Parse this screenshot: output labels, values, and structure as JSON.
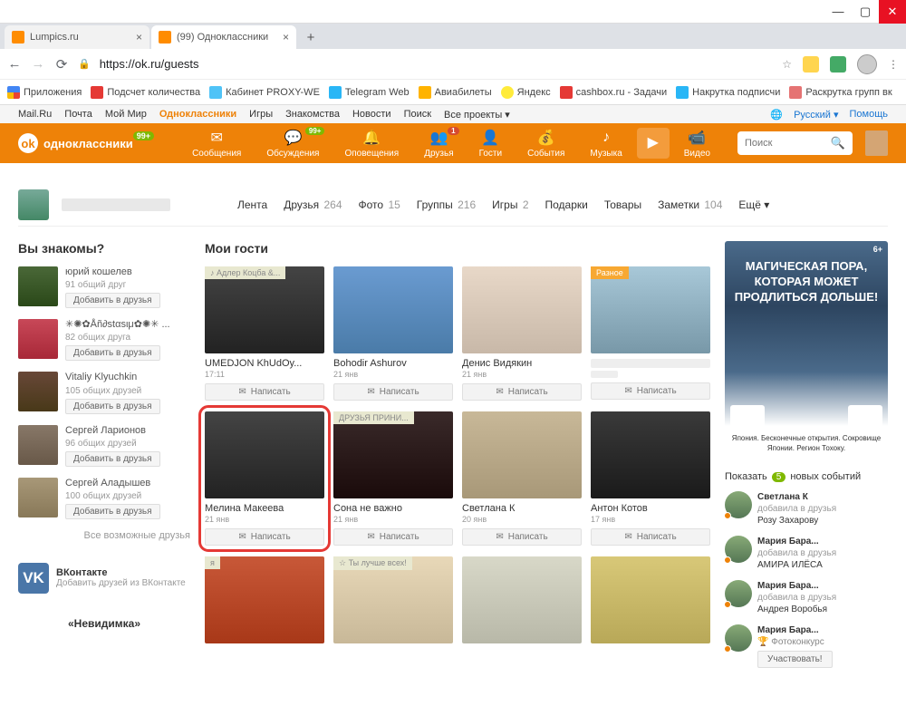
{
  "window": {
    "title": "(99) Одноклассники"
  },
  "tabs": [
    {
      "title": "Lumpics.ru",
      "active": false
    },
    {
      "title": "(99) Одноклассники",
      "active": true
    }
  ],
  "url": "https://ok.ru/guests",
  "bookmarks": [
    "Приложения",
    "Подсчет количества",
    "Кабинет PROXY-WE",
    "Telegram Web",
    "Авиабилеты",
    "Яндекс",
    "cashbox.ru - Задачи",
    "Накрутка подписчи",
    "Раскрутка групп вк"
  ],
  "mailru": {
    "links": [
      "Mail.Ru",
      "Почта",
      "Мой Мир",
      "Одноклассники",
      "Игры",
      "Знакомства",
      "Новости",
      "Поиск",
      "Все проекты ▾"
    ],
    "active_link": "Одноклассники",
    "lang": "Русский ▾",
    "help": "Помощь"
  },
  "ok_header": {
    "logo": "одноклассники",
    "logo_badge": "99+",
    "nav": [
      {
        "icon": "✉",
        "label": "Сообщения",
        "badge": ""
      },
      {
        "icon": "💬",
        "label": "Обсуждения",
        "badge": "99+"
      },
      {
        "icon": "🔔",
        "label": "Оповещения",
        "badge": ""
      },
      {
        "icon": "👥",
        "label": "Друзья",
        "badge": "1",
        "badge_red": true
      },
      {
        "icon": "👤",
        "label": "Гости",
        "badge": ""
      },
      {
        "icon": "💰",
        "label": "События",
        "badge": ""
      },
      {
        "icon": "♪",
        "label": "Музыка",
        "badge": ""
      }
    ],
    "play_label": "",
    "video_label": "Видео",
    "search_placeholder": "Поиск"
  },
  "profile_tabs": [
    {
      "label": "Лента",
      "count": ""
    },
    {
      "label": "Друзья",
      "count": "264"
    },
    {
      "label": "Фото",
      "count": "15"
    },
    {
      "label": "Группы",
      "count": "216"
    },
    {
      "label": "Игры",
      "count": "2"
    },
    {
      "label": "Подарки",
      "count": ""
    },
    {
      "label": "Товары",
      "count": ""
    },
    {
      "label": "Заметки",
      "count": "104"
    },
    {
      "label": "Ещё ▾",
      "count": ""
    }
  ],
  "suggestions": {
    "title": "Вы знакомы?",
    "items": [
      {
        "name": "юрий кошелев",
        "meta": "91 общий друг",
        "btn": "Добавить в друзья"
      },
      {
        "name": "✳✺✿Åñ∂stαsιμ✿✺✳ ...",
        "meta": "82 общих друга",
        "btn": "Добавить в друзья"
      },
      {
        "name": "Vitaliy Klyuchkin",
        "meta": "105 общих друзей",
        "btn": "Добавить в друзья"
      },
      {
        "name": "Сергей Ларионов",
        "meta": "96 общих друзей",
        "btn": "Добавить в друзья"
      },
      {
        "name": "Сергей Аладышев",
        "meta": "100 общих друзей",
        "btn": "Добавить в друзья"
      }
    ],
    "all": "Все возможные друзья"
  },
  "vk": {
    "title": "ВКонтакте",
    "sub": "Добавить друзей из ВКонтакте"
  },
  "invisible": "«Невидимка»",
  "guests": {
    "title": "Мои гости",
    "write_label": "Написать",
    "cards": [
      {
        "tag": "♪ Адлер Коцба &...",
        "name": "UMEDJON KhUdOy...",
        "date": "17:11",
        "gp": "gp1"
      },
      {
        "tag": null,
        "name": "Bohodir Ashurov",
        "date": "21 янв",
        "gp": "gp2"
      },
      {
        "tag": null,
        "name": "Денис Видякин",
        "date": "21 янв",
        "gp": "gp3"
      },
      {
        "tag": "Разное",
        "tag_orange": true,
        "name": "",
        "date": "",
        "gp": "gp4",
        "blurred": true
      },
      {
        "tag": null,
        "name": "Мелина Макеева",
        "date": "21 янв",
        "gp": "gp5",
        "highlighted": true
      },
      {
        "tag": "ДРУЗЬЯ ПРИНИ...",
        "name": "Сона не важно",
        "date": "21 янв",
        "gp": "gp6"
      },
      {
        "tag": null,
        "name": "Светлана К",
        "date": "20 янв",
        "gp": "gp7"
      },
      {
        "tag": null,
        "name": "Антон Котов",
        "date": "17 янв",
        "gp": "gp8"
      },
      {
        "tag": "я",
        "name": "",
        "date": "",
        "gp": "gp9",
        "partial": true
      },
      {
        "tag": "☆ Ты лучше всех!",
        "name": "",
        "date": "",
        "gp": "gp10",
        "partial": true
      },
      {
        "tag": null,
        "name": "",
        "date": "",
        "gp": "gp11",
        "partial": true
      },
      {
        "tag": null,
        "name": "",
        "date": "",
        "gp": "gp12",
        "partial": true
      }
    ]
  },
  "ad": {
    "age": "6+",
    "headline": "МАГИЧЕСКАЯ ПОРА, КОТОРАЯ МОЖЕТ ПРОДЛИТЬСЯ ДОЛЬШЕ!",
    "footer": "Япония. Бесконечные открытия. Сокровище Японии. Регион Тохоку."
  },
  "events": {
    "header_show": "Показать",
    "header_count": "5",
    "header_new": "новых событий",
    "items": [
      {
        "name": "Светлана К",
        "action": "добавила в друзья",
        "link": "Розу Захарову"
      },
      {
        "name": "Мария Бара...",
        "action": "добавила в друзья",
        "link": "АМИРА ИЛЁСА"
      },
      {
        "name": "Мария Бара...",
        "action": "добавила в друзья",
        "link": "Андрея Воробья"
      },
      {
        "name": "Мария Бара...",
        "contest": "Фотоконкурс",
        "participate": "Участвовать!"
      }
    ]
  }
}
